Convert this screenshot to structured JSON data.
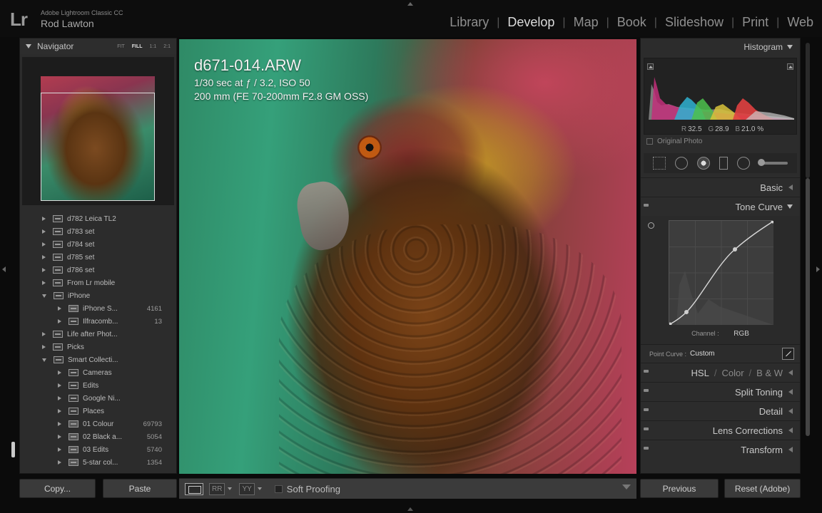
{
  "app": {
    "logo": "Lr",
    "brand": "Adobe Lightroom Classic CC",
    "user": "Rod Lawton"
  },
  "modules": [
    "Library",
    "Develop",
    "Map",
    "Book",
    "Slideshow",
    "Print",
    "Web"
  ],
  "active_module": "Develop",
  "navigator": {
    "title": "Navigator",
    "zooms": [
      "FIT",
      "FILL",
      "1:1",
      "2:1"
    ],
    "active_zoom": "FILL"
  },
  "folders": [
    {
      "label": "d782 Leica TL2",
      "count": ""
    },
    {
      "label": "d783 set",
      "count": ""
    },
    {
      "label": "d784 set",
      "count": ""
    },
    {
      "label": "d785 set",
      "count": ""
    },
    {
      "label": "d786 set",
      "count": ""
    },
    {
      "label": "From Lr mobile",
      "count": ""
    },
    {
      "label": "iPhone",
      "count": ""
    },
    {
      "label": "iPhone S...",
      "count": "4161"
    },
    {
      "label": "Ilfracomb...",
      "count": "13"
    },
    {
      "label": "Life after Phot...",
      "count": ""
    },
    {
      "label": "Picks",
      "count": ""
    },
    {
      "label": "Smart Collecti...",
      "count": ""
    },
    {
      "label": "Cameras",
      "count": ""
    },
    {
      "label": "Edits",
      "count": ""
    },
    {
      "label": "Google Ni...",
      "count": ""
    },
    {
      "label": "Places",
      "count": ""
    },
    {
      "label": "01 Colour",
      "count": "69793"
    },
    {
      "label": "02 Black a...",
      "count": "5054"
    },
    {
      "label": "03 Edits",
      "count": "5740"
    },
    {
      "label": "5-star col...",
      "count": "1354"
    }
  ],
  "left_buttons": {
    "copy": "Copy...",
    "paste": "Paste"
  },
  "photo": {
    "filename": "d671-014.ARW",
    "exposure": "1/30 sec at ƒ / 3.2, ISO 50",
    "lens": "200 mm (FE 70-200mm F2.8 GM OSS)"
  },
  "toolbar": {
    "compare_a": "RR",
    "compare_b": "YY",
    "soft_proofing": "Soft Proofing"
  },
  "histogram": {
    "title": "Histogram",
    "r_label": "R",
    "r": "32.5",
    "g_label": "G",
    "g": "28.9",
    "b_label": "B",
    "b": "21.0 %",
    "original_photo": "Original Photo"
  },
  "panels": {
    "basic": "Basic",
    "tone_curve": "Tone Curve",
    "hsl": "HSL",
    "color": "Color",
    "bw": "B & W",
    "split_toning": "Split Toning",
    "detail": "Detail",
    "lens_corrections": "Lens Corrections",
    "transform": "Transform"
  },
  "tone_curve": {
    "channel_label": "Channel :",
    "channel": "RGB",
    "point_curve_label": "Point Curve :",
    "point_curve": "Custom"
  },
  "right_buttons": {
    "previous": "Previous",
    "reset": "Reset (Adobe)"
  }
}
